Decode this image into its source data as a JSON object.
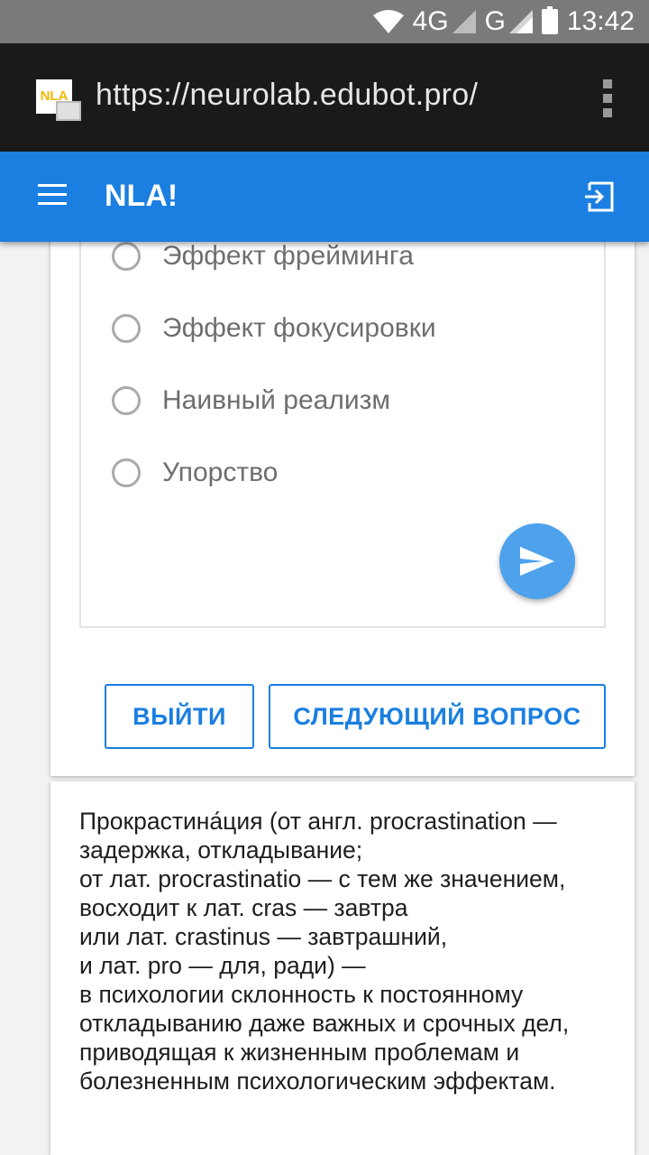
{
  "status_bar": {
    "network_4g": "4G",
    "network_g": "G",
    "time": "13:42"
  },
  "browser": {
    "url": "https://neurolab.edubot.pro/",
    "logo_text": "NLA"
  },
  "app_bar": {
    "title": "NLA!"
  },
  "quiz": {
    "options": [
      {
        "label": "Эффект фрейминга"
      },
      {
        "label": "Эффект фокусировки"
      },
      {
        "label": "Наивный реализм"
      },
      {
        "label": "Упорство"
      }
    ],
    "exit_label": "ВЫЙТИ",
    "next_label": "СЛЕДУЮЩИЙ ВОПРОС"
  },
  "info": {
    "text": "Прокрастина́ция (от англ. procrastination — задержка, откладывание;\nот лат. procrastinatio — с тем же значением, восходит к лат. cras — завтра\nили лат. crastinus — завтрашний,\nи лат. pro — для, ради) —\nв психологии склонность к постоянному откладыванию даже важных и срочных дел, приводящая к жизненным проблемам и болезненным психологическим эффектам."
  },
  "colors": {
    "primary": "#1a7fe0",
    "fab": "#4ea2ec",
    "url_bar": "#1a1a1a",
    "status_bar": "#7a7a7a"
  },
  "icons": [
    "wifi-icon",
    "signal-icon",
    "battery-icon",
    "lock-icon",
    "more-vert-icon",
    "menu-icon",
    "logout-icon",
    "send-icon"
  ]
}
